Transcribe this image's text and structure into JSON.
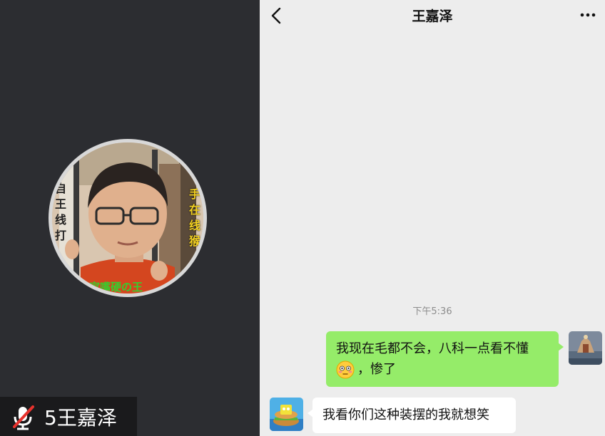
{
  "call": {
    "participant_label": "5王嘉泽",
    "avatar_text_left": "自\n王\n线\n打",
    "avatar_text_right": "手\n在\n线\n猴",
    "avatar_text_bottom": "家嘴硬の王"
  },
  "chat": {
    "title": "王嘉泽",
    "timestamp": "下午5:36",
    "messages": [
      {
        "sender": "me",
        "text_line1": "我现在毛都不会，八科一点看不懂",
        "text_line2": "，惨了",
        "emoji": "flushed-face-emoji"
      },
      {
        "sender": "other",
        "text": "我看你们这种装摆的我就想笑"
      }
    ]
  },
  "colors": {
    "call_background": "#2c2d31",
    "chat_background": "#ededed",
    "my_bubble": "#95ec69",
    "other_bubble": "#ffffff"
  },
  "icons": {
    "back": "back-arrow-icon",
    "more": "more-options-icon",
    "mic_muted": "mic-muted-icon"
  }
}
